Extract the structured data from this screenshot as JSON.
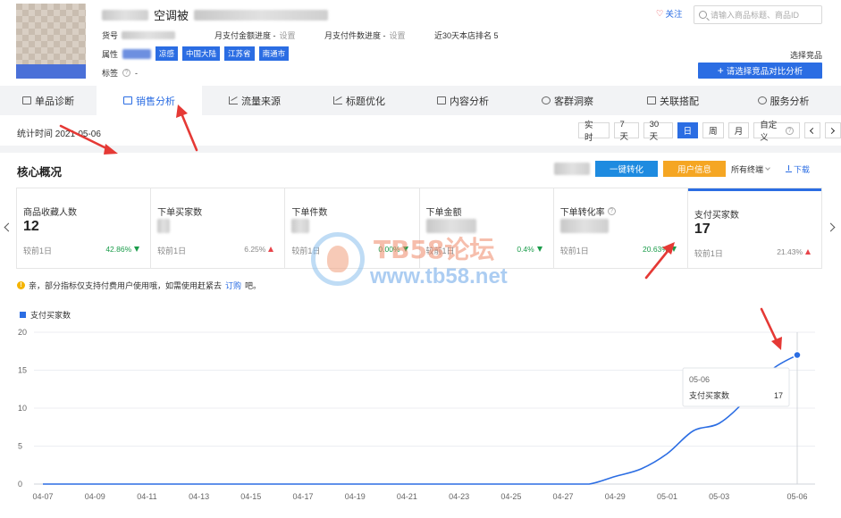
{
  "header": {
    "title_visible": "空调被",
    "meta": {
      "sku_label": "货号",
      "pay_amount_label": "月支付金额进度 -",
      "pay_count_label": "月支付件数进度 -",
      "setting_label": "设置",
      "rank_label": "近30天本店排名 5"
    },
    "attr_label": "属性",
    "tags": [
      "凉感",
      "中国大陆",
      "江苏省",
      "南通市"
    ],
    "label_label": "标签",
    "label_value": "-",
    "follow_label": "关注",
    "search_placeholder": "请输入商品标题、商品ID",
    "select_link": "选择竞品",
    "compare_button": "请选择竞品对比分析"
  },
  "tabs": [
    {
      "label": "单品诊断",
      "active": false
    },
    {
      "label": "销售分析",
      "active": true
    },
    {
      "label": "流量来源",
      "active": false
    },
    {
      "label": "标题优化",
      "active": false
    },
    {
      "label": "内容分析",
      "active": false
    },
    {
      "label": "客群洞察",
      "active": false
    },
    {
      "label": "关联搭配",
      "active": false
    },
    {
      "label": "服务分析",
      "active": false
    }
  ],
  "statbar": {
    "time_label": "统计时间 2021-05-06",
    "buttons": [
      "实 时",
      "7天",
      "30天",
      "日",
      "周",
      "月",
      "自定义"
    ],
    "active_button": "日"
  },
  "core": {
    "title": "核心概况",
    "convert_button": "一键转化",
    "user_info_button": "用户信息",
    "terminal_label": "所有终端",
    "download_label": "下载"
  },
  "cards": [
    {
      "name": "商品收藏人数",
      "value": "12",
      "compare": "较前1日",
      "pct": "42.86%",
      "trend": "down"
    },
    {
      "name": "下单买家数",
      "value": "",
      "compare": "较前1日",
      "pct": "6.25%",
      "trend": "up"
    },
    {
      "name": "下单件数",
      "value": "",
      "compare": "较前1日",
      "pct": "0.00%",
      "trend": "down"
    },
    {
      "name": "下单金额",
      "value": "",
      "compare": "较前1日",
      "pct": "0.4%",
      "trend": "down"
    },
    {
      "name": "下单转化率",
      "value": "",
      "compare": "较前1日",
      "pct": "20.63%",
      "trend": "down"
    },
    {
      "name": "支付买家数",
      "value": "17",
      "compare": "较前1日",
      "pct": "21.43%",
      "trend": "up"
    }
  ],
  "notice": {
    "text": "亲，部分指标仅支持付费用户使用哦，如需使用赶紧去",
    "link": "订购",
    "suffix": "吧。"
  },
  "watermark": {
    "line1": "TB58论坛",
    "line2": "www.tb58.net"
  },
  "colors": {
    "accent": "#2b6de3",
    "up": "#e8444a",
    "down": "#1a9c4a",
    "orange": "#f5a623"
  },
  "chart_data": {
    "type": "line",
    "x": [
      "04-07",
      "04-08",
      "04-09",
      "04-10",
      "04-11",
      "04-12",
      "04-13",
      "04-14",
      "04-15",
      "04-16",
      "04-17",
      "04-18",
      "04-19",
      "04-20",
      "04-21",
      "04-22",
      "04-23",
      "04-24",
      "04-25",
      "04-26",
      "04-27",
      "04-28",
      "04-29",
      "04-30",
      "05-01",
      "05-02",
      "05-03",
      "05-04",
      "05-05",
      "05-06"
    ],
    "x_tick_labels": [
      "04-07",
      "04-09",
      "04-11",
      "04-13",
      "04-15",
      "04-17",
      "04-19",
      "04-21",
      "04-23",
      "04-25",
      "04-27",
      "04-29",
      "05-01",
      "05-03",
      "05-06"
    ],
    "series": [
      {
        "name": "支付买家数",
        "values": [
          0,
          0,
          0,
          0,
          0,
          0,
          0,
          0,
          0,
          0,
          0,
          0,
          0,
          0,
          0,
          0,
          0,
          0,
          0,
          0,
          0,
          0,
          1,
          2,
          4,
          7,
          8,
          11,
          15,
          17
        ]
      }
    ],
    "ylim": [
      0,
      20
    ],
    "yticks": [
      0,
      5,
      10,
      15,
      20
    ],
    "grid": true,
    "legend": "top-left",
    "tooltip": {
      "date": "05-06",
      "label": "支付买家数",
      "value": "17"
    }
  }
}
